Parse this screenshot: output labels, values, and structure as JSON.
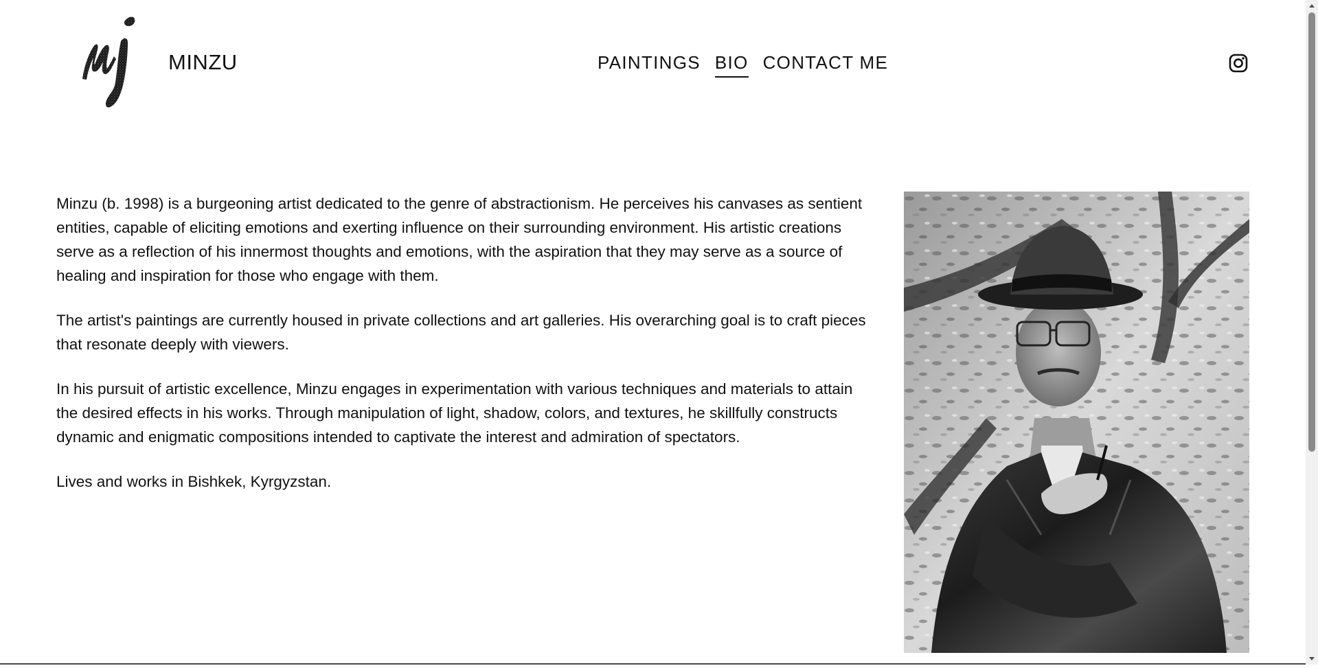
{
  "header": {
    "site_title": "MINZU",
    "logo_icon": "mj-brush-logo-icon",
    "nav": [
      {
        "label": "PAINTINGS",
        "active": false
      },
      {
        "label": "BIO",
        "active": true
      },
      {
        "label": "CONTACT ME",
        "active": false
      }
    ],
    "social_icon": "instagram-icon"
  },
  "bio": {
    "paragraphs": [
      "Minzu (b. 1998) is a burgeoning artist dedicated to the genre of abstractionism. He perceives his canvases as sentient entities, capable of eliciting emotions and exerting influence on their surrounding environment. His artistic creations serve as a reflection of his innermost thoughts and emotions, with the aspiration that they may serve as a source of healing and inspiration for those who engage with them.",
      "The artist's paintings are currently housed in private collections and art galleries. His overarching goal is to craft pieces that resonate deeply with viewers.",
      "In his pursuit of artistic excellence, Minzu engages in experimentation with various techniques and materials to attain the desired effects in his works. Through manipulation of light, shadow, colors, and textures, he skillfully constructs dynamic and enigmatic compositions intended to captivate the interest and admiration of spectators.",
      "Lives and works in Bishkek, Kyrgyzstan."
    ]
  },
  "colors": {
    "text": "#111111",
    "background": "#ffffff",
    "scrollbar_thumb": "#8a8a8a"
  }
}
